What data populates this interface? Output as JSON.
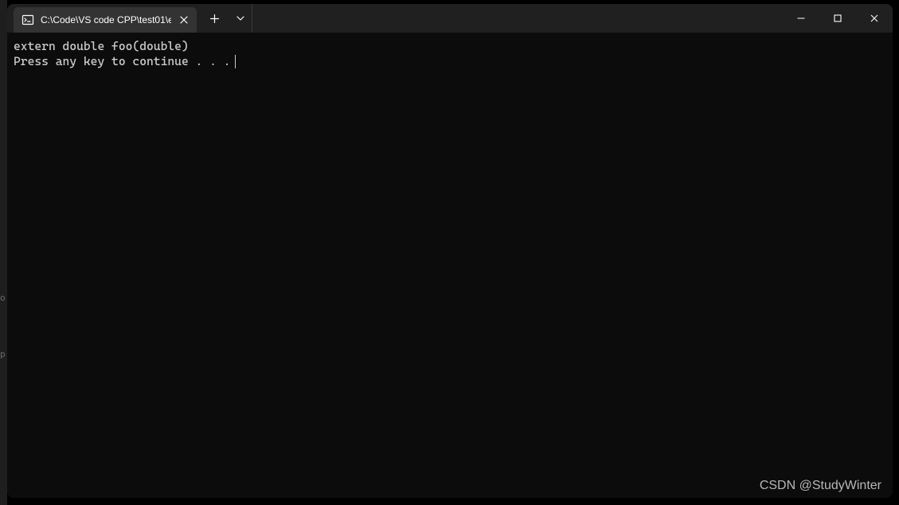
{
  "tab": {
    "title": "C:\\Code\\VS code CPP\\test01\\e"
  },
  "terminal": {
    "line1": "extern double foo(double)",
    "line2": "Press any key to continue . . ."
  },
  "watermark": "CSDN @StudyWinter",
  "edge": {
    "c1": "o",
    "c2": "p"
  }
}
